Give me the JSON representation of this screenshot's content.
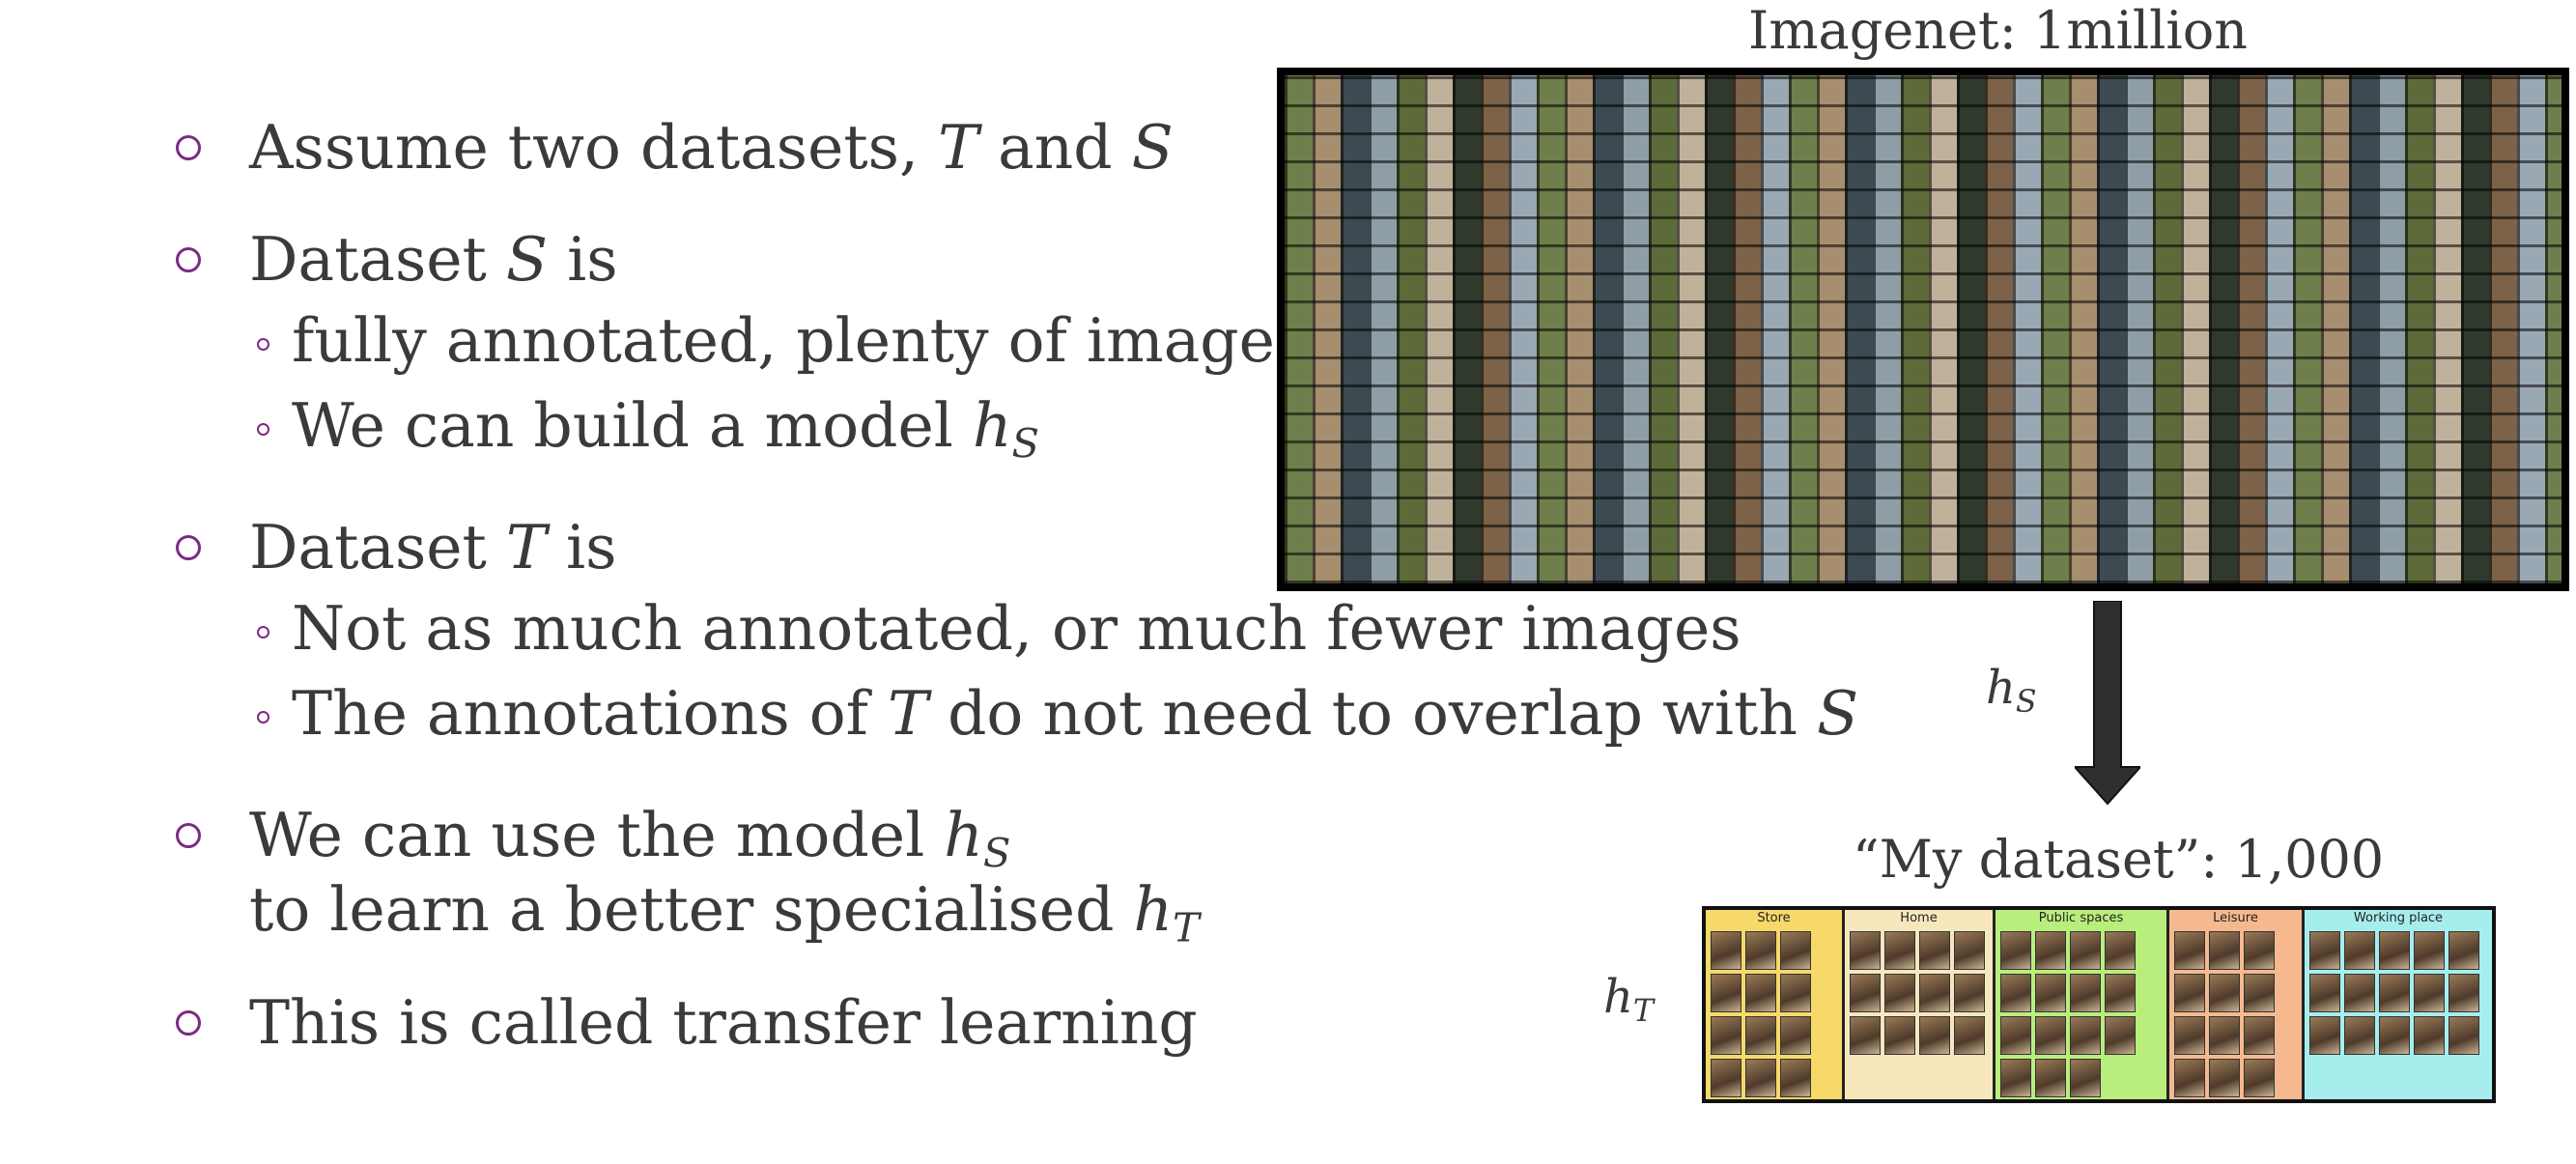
{
  "bullets": [
    {
      "pre": "Assume two datasets, ",
      "m1": "T",
      "mid": " and ",
      "m2": "S"
    },
    {
      "pre": "Dataset ",
      "m1": "S",
      "post": " is"
    },
    {
      "pre": "fully annotated, plenty of images"
    },
    {
      "pre": "We can build a model ",
      "m1": "h",
      "s1": "S"
    },
    {
      "pre": "Dataset ",
      "m1": "T",
      "post": " is"
    },
    {
      "pre": "Not as much annotated, or much fewer images"
    },
    {
      "pre": "The annotations of ",
      "m1": "T",
      "mid": " do not need to overlap with ",
      "m2": "S"
    },
    {
      "pre": "We can use the model ",
      "m1": "h",
      "s1": "S",
      "line2pre": "to learn a better specialised ",
      "m2": "h",
      "s2": "T"
    },
    {
      "pre": "This is called transfer learning"
    }
  ],
  "imagenet_label": "Imagenet: 1million",
  "mydataset_label": "“My dataset”: 1,000",
  "arrow_label": {
    "base": "h",
    "sub": "S"
  },
  "target_label": {
    "base": "h",
    "sub": "T"
  },
  "panels": [
    {
      "title": "Store",
      "color": "#f7d96a"
    },
    {
      "title": "Home",
      "color": "#f6e7bd"
    },
    {
      "title": "Public spaces",
      "color": "#b9ee7c"
    },
    {
      "title": "Leisure",
      "color": "#f6b98f"
    },
    {
      "title": "Working place",
      "color": "#a6eeee"
    }
  ]
}
